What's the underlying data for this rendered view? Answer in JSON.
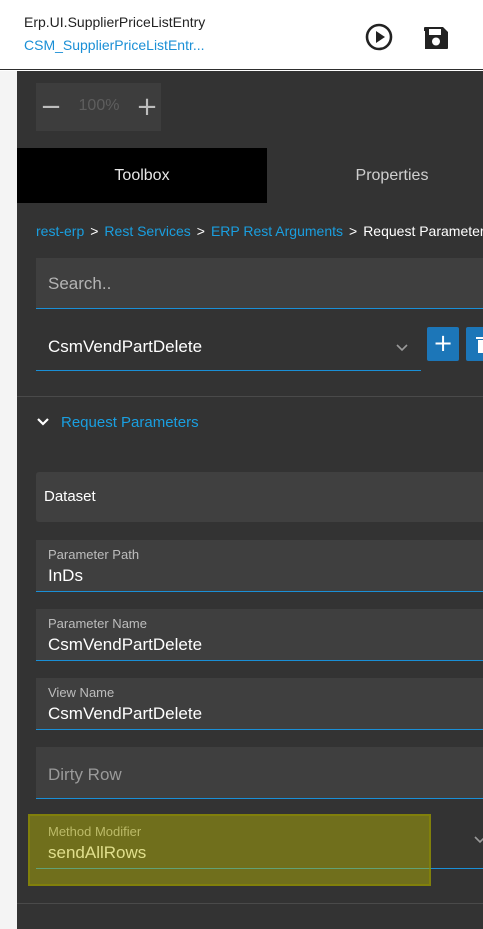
{
  "header": {
    "title": "Erp.UI.SupplierPriceListEntry",
    "subtitle": "CSM_SupplierPriceListEntr...",
    "play_icon": "play-circle-icon",
    "save_icon": "save-icon"
  },
  "zoom": {
    "minus": "−",
    "value": "100%",
    "plus": "+"
  },
  "tabs": [
    {
      "label": "Toolbox",
      "active": true
    },
    {
      "label": "Properties",
      "active": false
    }
  ],
  "breadcrumb": {
    "items": [
      "rest-erp",
      "Rest Services",
      "ERP Rest Arguments"
    ],
    "current": "Request Parameters",
    "separator": ">"
  },
  "search": {
    "placeholder": "Search.."
  },
  "selector": {
    "value": "CsmVendPartDelete",
    "add_label": "+"
  },
  "section": {
    "label": "Request Parameters",
    "expanded": true
  },
  "dataset": {
    "label": "Dataset",
    "more": "⋮"
  },
  "fields": [
    {
      "label": "Parameter Path",
      "value": "InDs"
    },
    {
      "label": "Parameter Name",
      "value": "CsmVendPartDelete"
    },
    {
      "label": "View Name",
      "value": "CsmVendPartDelete"
    },
    {
      "label": "Dirty Row",
      "value": ""
    }
  ],
  "method_modifier": {
    "label": "Method Modifier",
    "value": "sendAllRows"
  },
  "colors": {
    "accent": "#1a8fd6",
    "panel": "#333333",
    "highlight": "#bab800"
  }
}
